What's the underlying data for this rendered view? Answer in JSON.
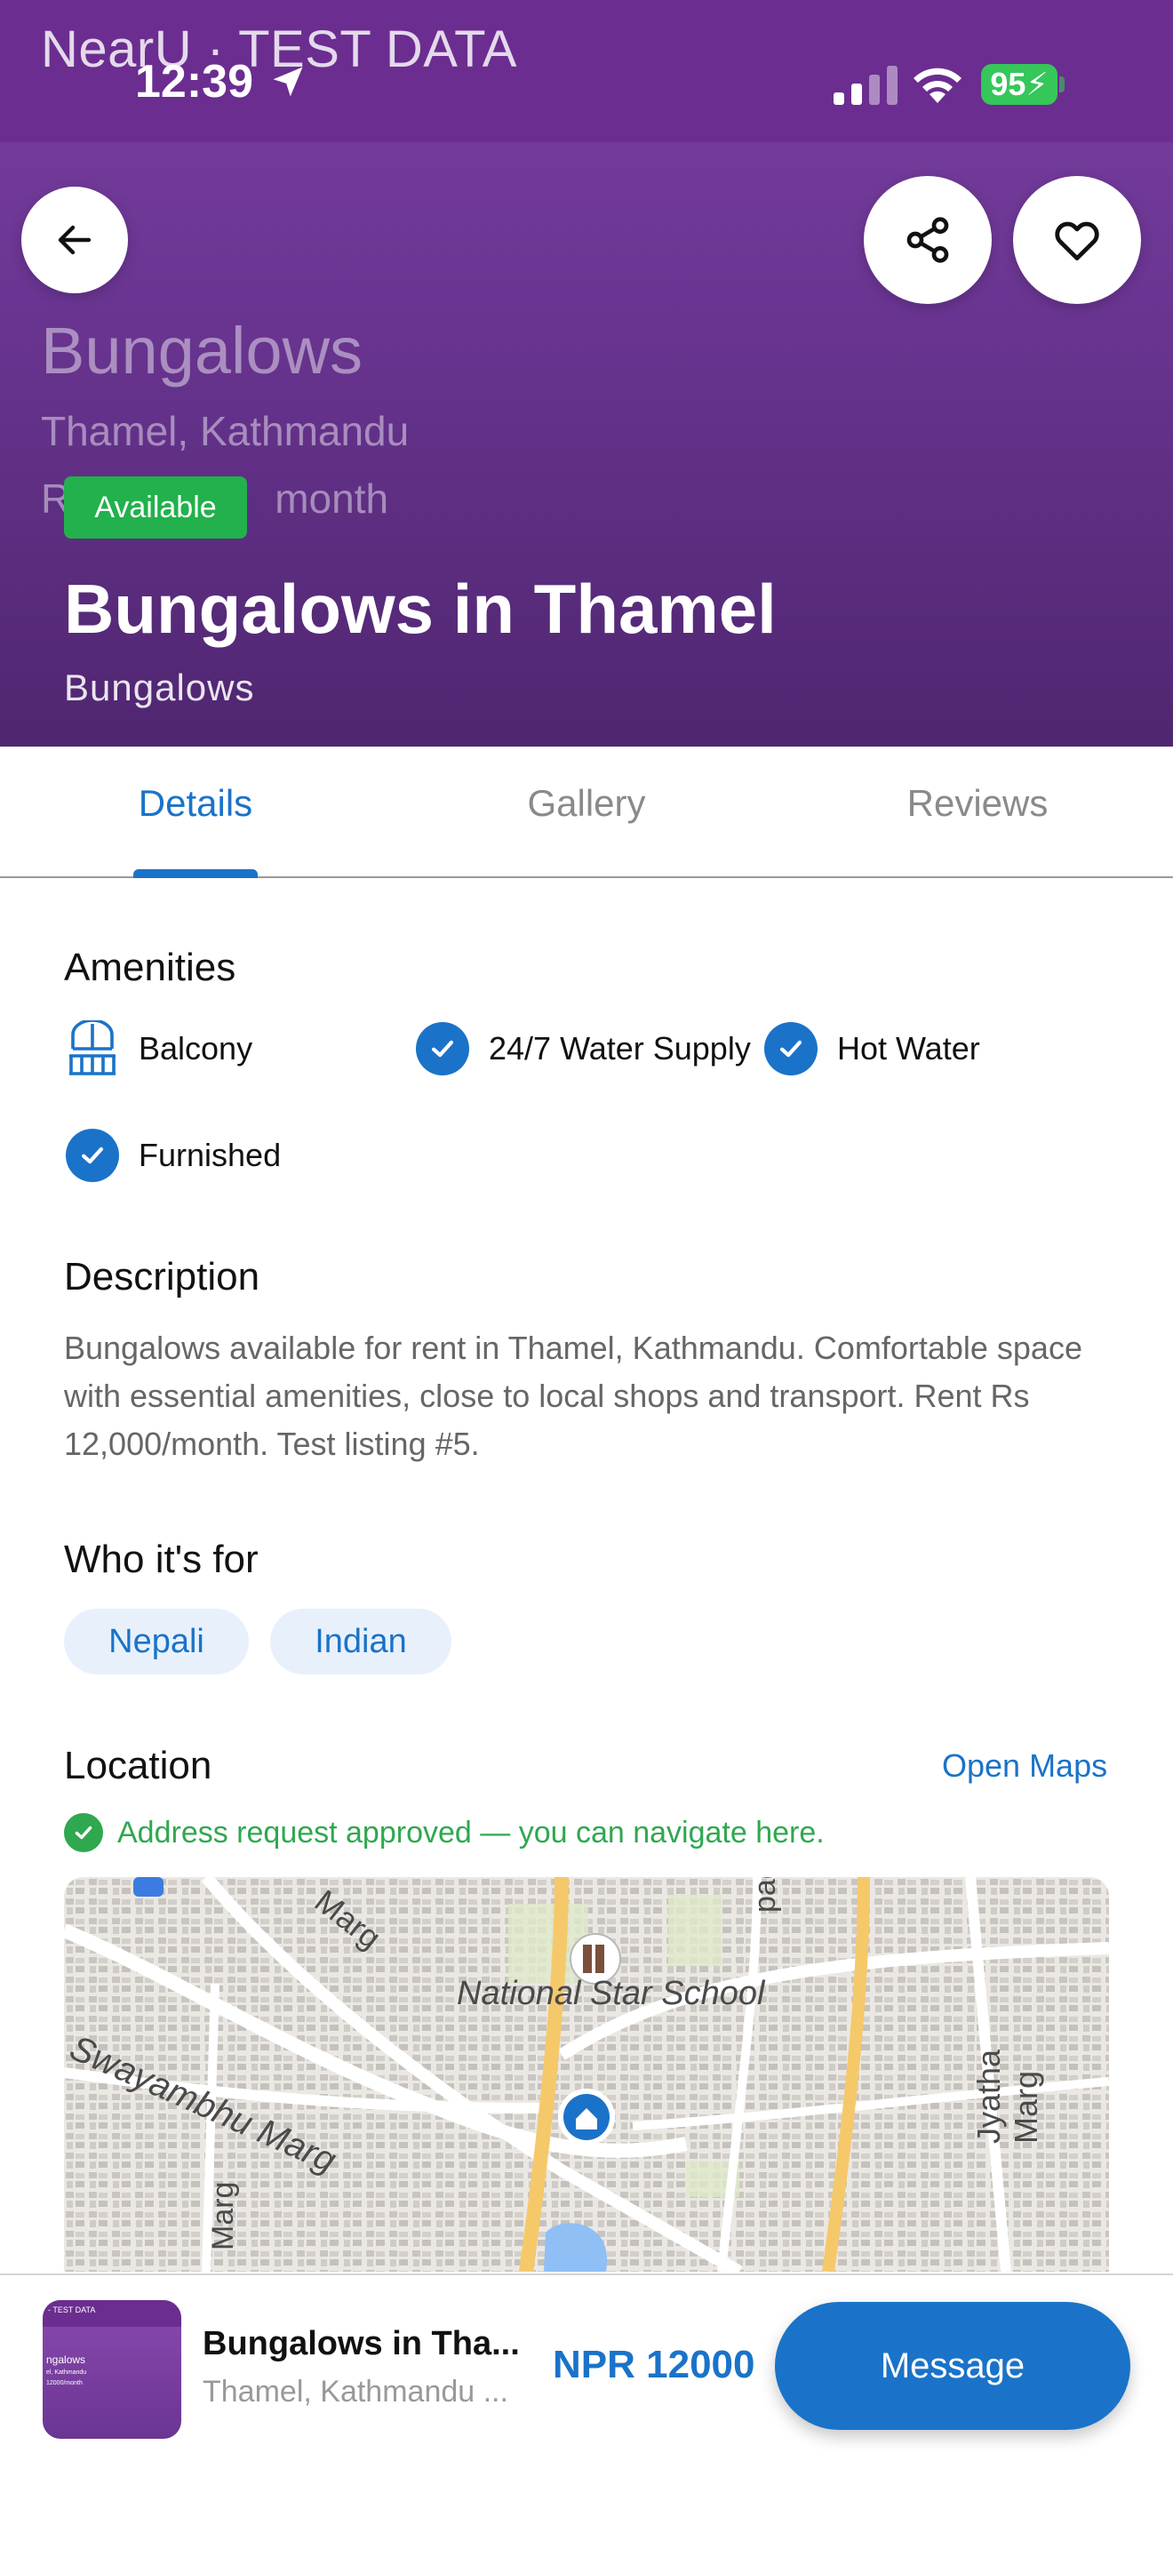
{
  "status_bar": {
    "time": "12:39",
    "battery": "95"
  },
  "hero": {
    "image_overlay_title": "NearU · TEST DATA",
    "image_title": "Bungalows",
    "image_subtitle": "Thamel, Kathmandu",
    "image_rent_fragment": "R",
    "image_rent_suffix": "month",
    "status_badge": "Available",
    "title": "Bungalows in Thamel",
    "category": "Bungalows"
  },
  "tabs": [
    {
      "label": "Details",
      "active": true
    },
    {
      "label": "Gallery",
      "active": false
    },
    {
      "label": "Reviews",
      "active": false
    }
  ],
  "amenities": {
    "heading": "Amenities",
    "items": [
      {
        "label": "Balcony",
        "icon": "balcony-icon"
      },
      {
        "label": "24/7 Water Supply",
        "icon": "check-icon"
      },
      {
        "label": "Hot Water",
        "icon": "check-icon"
      },
      {
        "label": "Furnished",
        "icon": "check-icon"
      }
    ]
  },
  "description": {
    "heading": "Description",
    "text": "Bungalows available for rent in Thamel, Kathmandu. Comfortable space with essential amenities, close to local shops and transport. Rent Rs 12,000/month. Test listing #5."
  },
  "audience": {
    "heading": "Who it's for",
    "chips": [
      "Nepali",
      "Indian"
    ]
  },
  "location": {
    "heading": "Location",
    "open_maps": "Open Maps",
    "approved_note": "Address request approved — you can navigate here.",
    "map_labels": {
      "school": "National Star School",
      "road1": "Swayambhu Marg",
      "road2": "Jyatha Marg",
      "road3": "Marg",
      "road4": "Marg",
      "road5": "pad"
    }
  },
  "bottom_bar": {
    "title": "Bungalows in Tha...",
    "subtitle": "Thamel, Kathmandu ...",
    "price": "NPR 12000",
    "message_label": "Message",
    "thumb_band": "- TEST DATA",
    "thumb_title": "ngalows",
    "thumb_sub": "el, Kathmandu",
    "thumb_rent": "12000/month"
  },
  "colors": {
    "accent": "#1a73c8",
    "hero_purple": "#6b2d90",
    "available_green": "#22b14c",
    "approved_green": "#2fa84f"
  }
}
